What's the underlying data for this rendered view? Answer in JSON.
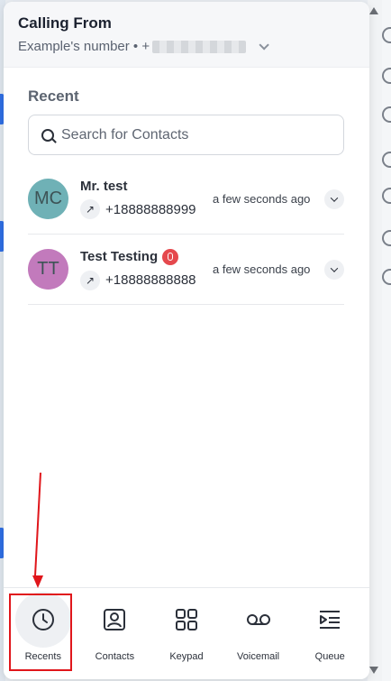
{
  "header": {
    "title": "Calling From",
    "number_label": "Example's number • +"
  },
  "recent": {
    "title": "Recent",
    "search_placeholder": "Search for Contacts",
    "calls": [
      {
        "initials": "MC",
        "name": "Mr. test",
        "number": "+18888888999",
        "time": "a few seconds ago",
        "avatar_color": "#6fb1b6",
        "direction_icon": "arrow-up-right-icon",
        "has_recording": false
      },
      {
        "initials": "TT",
        "name": "Test Testing",
        "number": "+18888888888",
        "time": "a few seconds ago",
        "avatar_color": "#c27abc",
        "direction_icon": "arrow-up-right-icon",
        "has_recording": true
      }
    ]
  },
  "nav": {
    "items": [
      {
        "label": "Recents",
        "icon": "clock-icon",
        "active": true
      },
      {
        "label": "Contacts",
        "icon": "contact-card-icon",
        "active": false
      },
      {
        "label": "Keypad",
        "icon": "grid-icon",
        "active": false
      },
      {
        "label": "Voicemail",
        "icon": "voicemail-icon",
        "active": false
      },
      {
        "label": "Queue",
        "icon": "queue-icon",
        "active": false
      }
    ]
  },
  "colors": {
    "accent_annotation": "#e0161b",
    "recording_badge": "#e5484d"
  }
}
